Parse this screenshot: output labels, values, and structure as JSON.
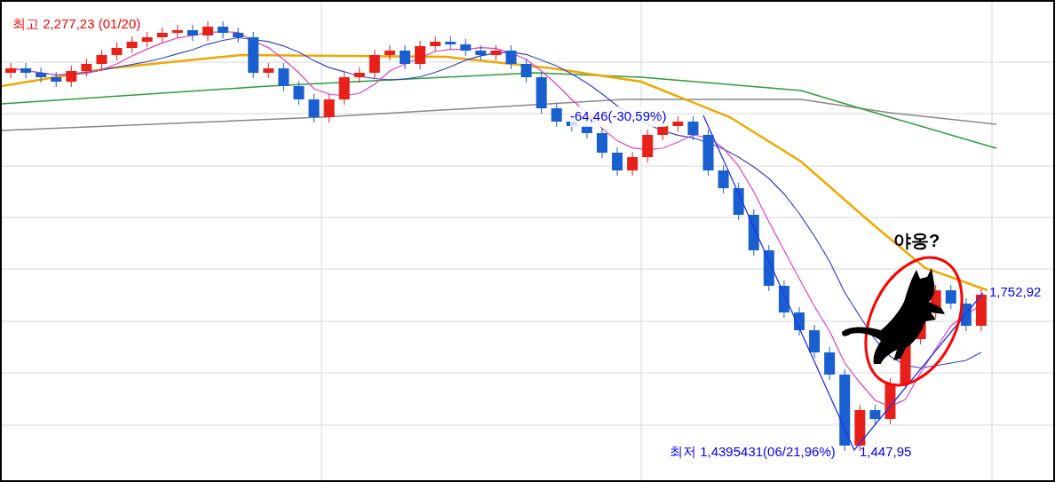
{
  "chart_labels": [
    {
      "kind": "high",
      "text": "최고 2,277,23 (01/20)",
      "color": "#ff0000"
    },
    {
      "kind": "change",
      "text": "-64,46(-30,59%)",
      "color": "#0000ff"
    },
    {
      "kind": "low",
      "text": "최저 1,4395431(06/21,96%)",
      "color": "#0000ff"
    },
    {
      "kind": "low_value",
      "text": "1,447,95",
      "color": "#0000ff"
    },
    {
      "kind": "last",
      "text": "1,752,92",
      "color": "#0000ff"
    }
  ],
  "callout": {
    "text": "야옹?"
  }
}
